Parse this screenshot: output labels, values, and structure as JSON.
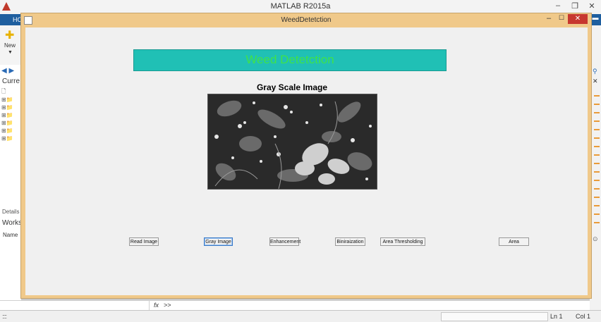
{
  "main_window": {
    "title": "MATLAB R2015a",
    "ribbon_tab": "HO",
    "new_label": "New",
    "current_folder_label": "Curre",
    "details_label": "Details",
    "workspace_label": "Works",
    "workspace_name_header": "Name",
    "command_prompt": ">>",
    "fx_label": "fx",
    "status": {
      "ln_label": "Ln",
      "ln_value": "1",
      "col_label": "Col",
      "col_value": "1"
    }
  },
  "figure": {
    "window_title": "WeedDetetction",
    "banner_text": "Weed Detetction",
    "axes_title": "Gray Scale Image",
    "buttons": [
      {
        "label": "Read Image"
      },
      {
        "label": "Gray Image",
        "selected": true
      },
      {
        "label": "Enhancement"
      },
      {
        "label": "Biniraization"
      },
      {
        "label": "Area Thresholding"
      },
      {
        "label": "Area"
      }
    ]
  },
  "colors": {
    "banner_bg": "#20c0b5",
    "banner_text": "#3fe24a",
    "figure_frame": "#f0c98a",
    "close_button": "#c7372f",
    "ribbon_blue": "#1f5f9f"
  },
  "icons": [
    "matlab-logo-icon",
    "new-script-icon",
    "back-arrow-icon",
    "forward-arrow-icon",
    "folder-icon",
    "search-icon",
    "close-icon",
    "fx-icon"
  ]
}
